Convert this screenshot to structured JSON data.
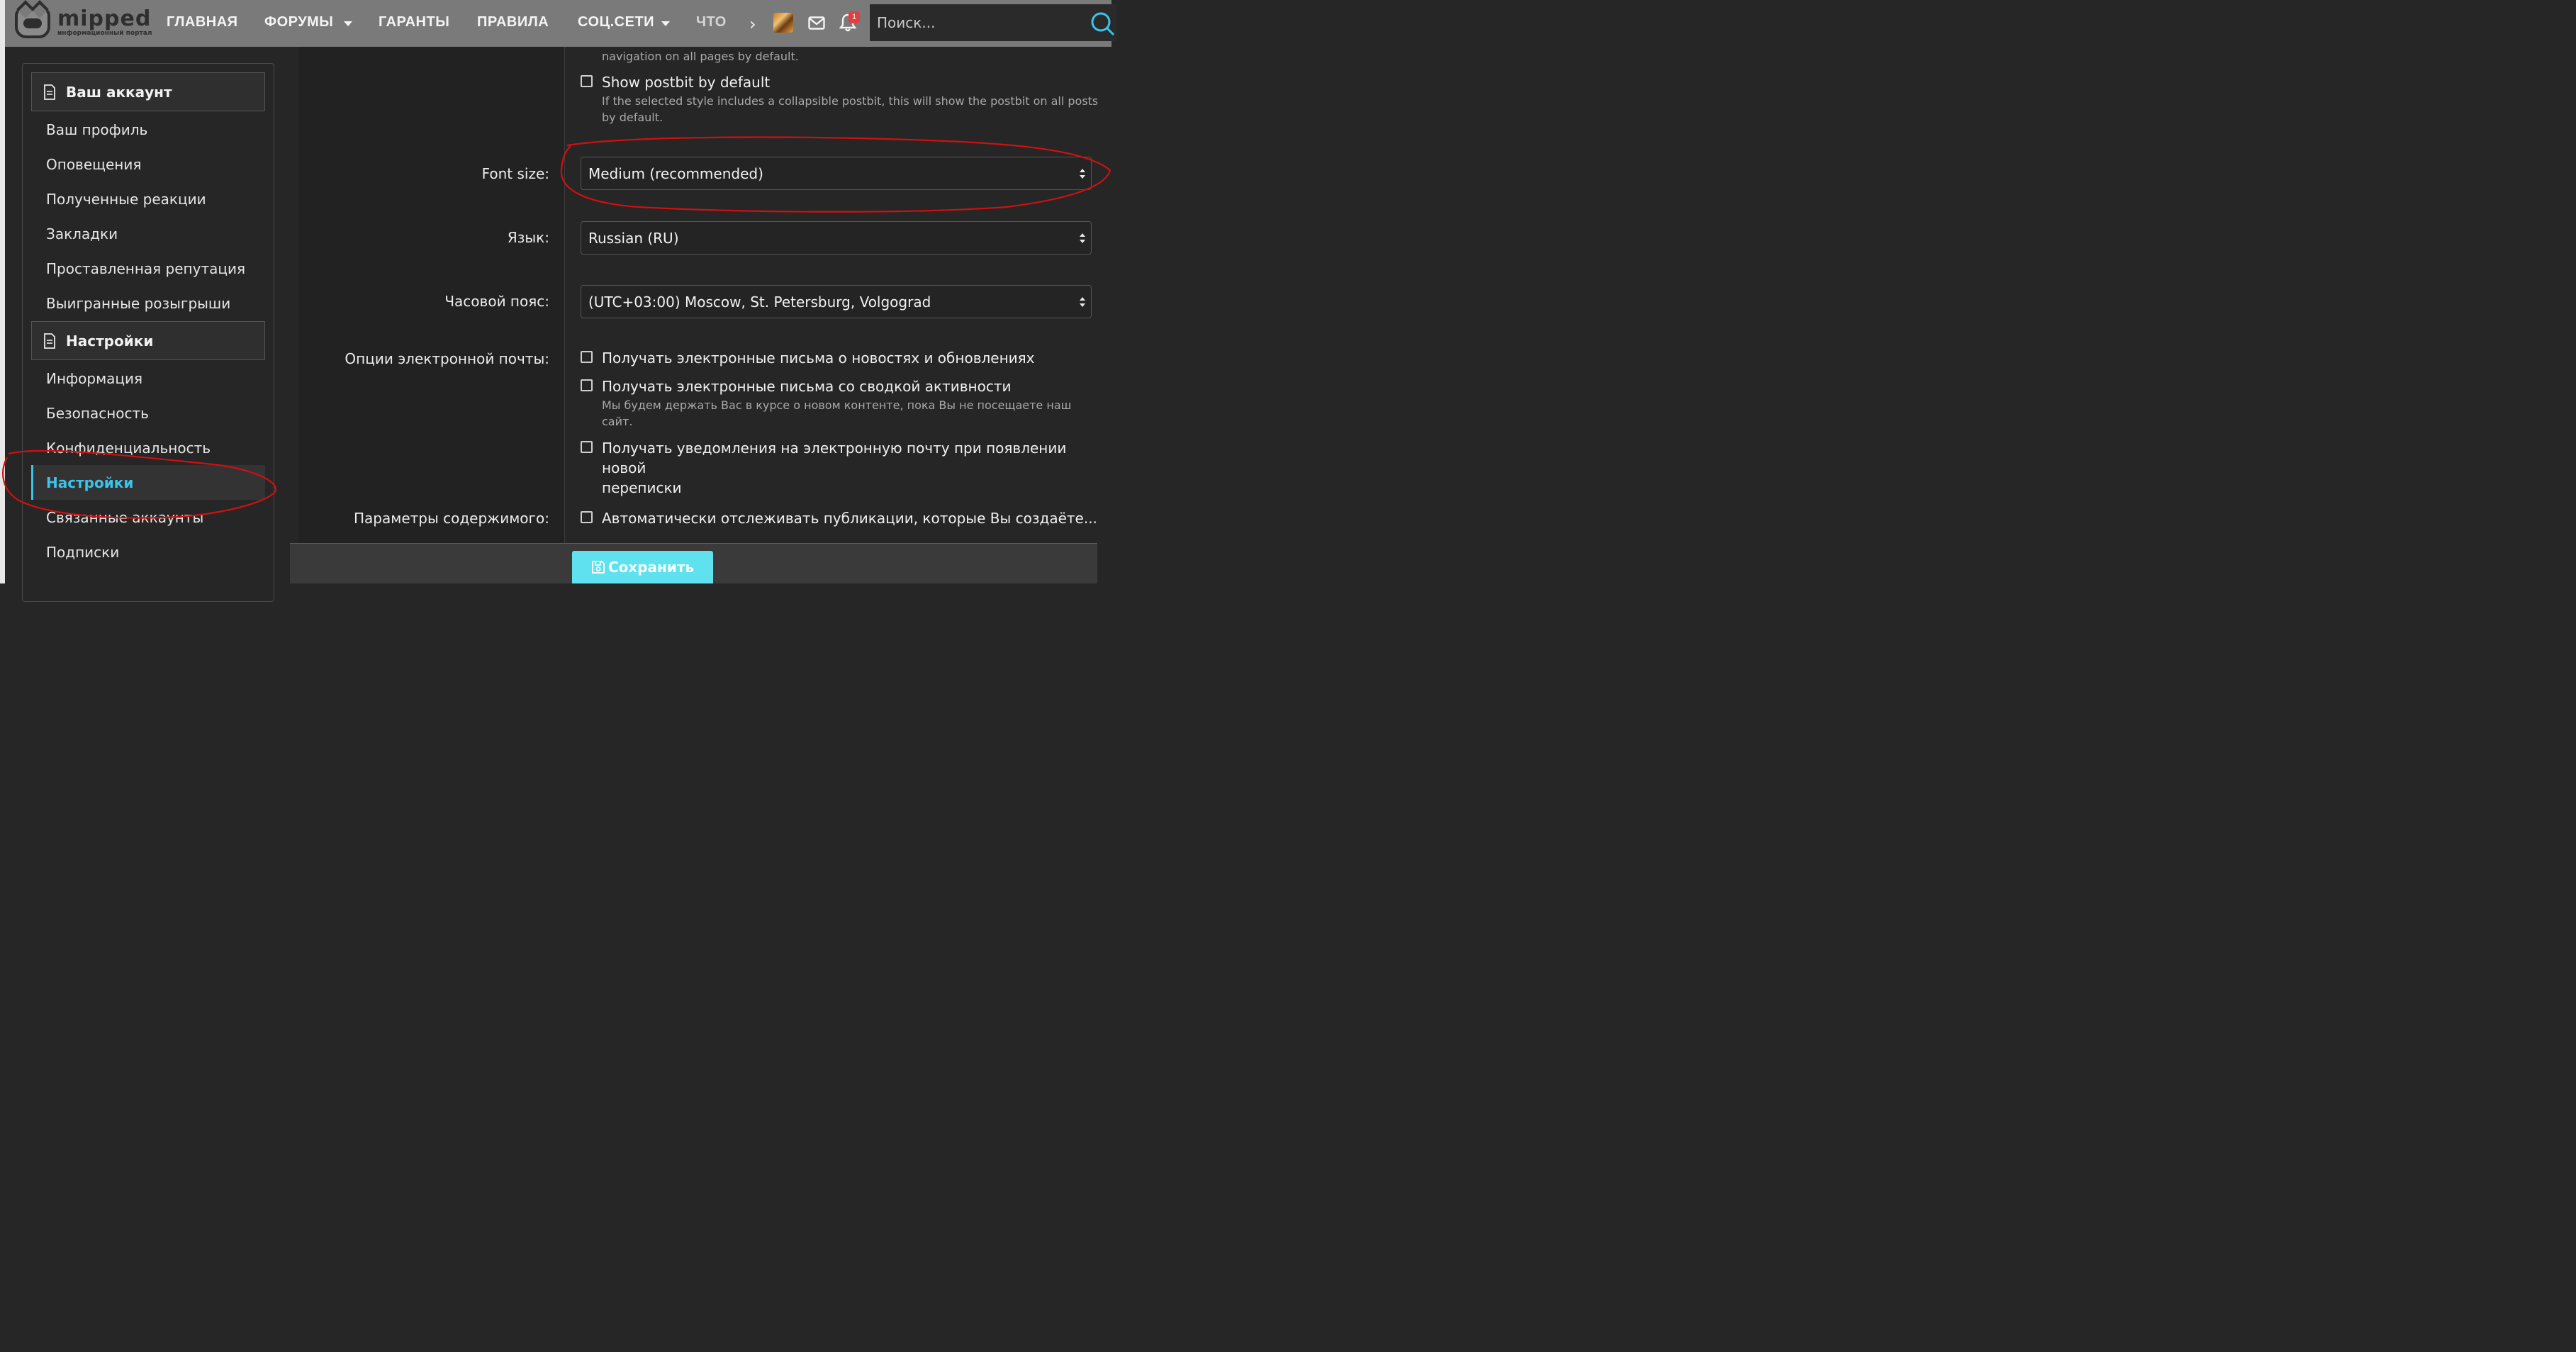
{
  "brand": {
    "name": "mipped",
    "tagline": "информационный портал"
  },
  "nav": {
    "items": [
      {
        "label": "ГЛАВНАЯ",
        "has_dropdown": false
      },
      {
        "label": "ФОРУМЫ",
        "has_dropdown": true
      },
      {
        "label": "ГАРАНТЫ",
        "has_dropdown": false
      },
      {
        "label": "ПРАВИЛА",
        "has_dropdown": false
      },
      {
        "label": "СОЦ.СЕТИ",
        "has_dropdown": true
      },
      {
        "label": "ЧТО",
        "has_dropdown": false
      }
    ],
    "more_glyph": "›",
    "notification_count": "1",
    "search_placeholder": "Поиск..."
  },
  "sidebar": {
    "sections": [
      {
        "header": "Ваш аккаунт",
        "items": [
          "Ваш профиль",
          "Оповещения",
          "Полученные реакции",
          "Закладки",
          "Проставленная репутация",
          "Выигранные розыгрыши"
        ]
      },
      {
        "header": "Настройки",
        "items": [
          "Информация",
          "Безопасность",
          "Конфиденциальность",
          "Настройки",
          "Связанные аккаунты",
          "Подписки"
        ]
      }
    ],
    "active_item": "Настройки"
  },
  "form": {
    "top_hint": "navigation on all pages by default.",
    "show_postbit": {
      "label": "Show postbit by default",
      "hint_line1": "If the selected style includes a collapsible postbit, this will show the postbit on all posts",
      "hint_line2": "by default.",
      "checked": false
    },
    "font_size": {
      "label": "Font size:",
      "value": "Medium (recommended)"
    },
    "language": {
      "label": "Язык:",
      "value": "Russian (RU)"
    },
    "timezone": {
      "label": "Часовой пояс:",
      "value": "(UTC+03:00) Moscow, St. Petersburg, Volgograd"
    },
    "email_options": {
      "label": "Опции электронной почты:",
      "news": {
        "label": "Получать электронные письма о новостях и обновлениях",
        "checked": false
      },
      "digest": {
        "label": "Получать электронные письма со сводкой активности",
        "hint_line1": "Мы будем держать Вас в курсе о новом контенте, пока Вы не посещаете наш",
        "hint_line2": "сайт.",
        "checked": false
      },
      "conversation": {
        "label_line1": "Получать уведомления на электронную почту при появлении новой",
        "label_line2": "переписки",
        "checked": false
      }
    },
    "content_options": {
      "label": "Параметры содержимого:",
      "auto_watch": {
        "label": "Автоматически отслеживать публикации, которые Вы создаёте...",
        "checked": false
      }
    }
  },
  "actions": {
    "save_label": "Сохранить"
  },
  "colors": {
    "accent": "#3bc3e9",
    "save_button": "#5fe1ef",
    "topbar": "#7a7a7a",
    "background": "#262626",
    "annotation": "#d01010",
    "badge": "#e04040"
  }
}
